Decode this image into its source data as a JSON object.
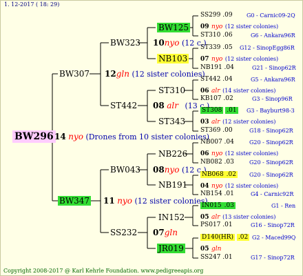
{
  "header": {
    "date": "1. 12-2017 ( 18: 29)"
  },
  "footer": {
    "copyright": "Copyright 2008-2017 @ Karl Kehrle Foundation.   www.pedigreeapis.org"
  },
  "root": {
    "id": "BW296",
    "gen": "14",
    "note_red": "nyo",
    "note": "(Drones from 10 sister colonies)"
  },
  "gen2": {
    "a": {
      "id": "BW307",
      "gen": "12",
      "note_red": "gln",
      "note": "(12 sister colonies)"
    },
    "b": {
      "id": "BW347",
      "gen": "11",
      "note_red": "nyo",
      "note": "(12 sister colonies)"
    }
  },
  "gen3": {
    "a": {
      "id": "BW323",
      "gen": "10",
      "note_red": "nyo",
      "note": "(12 c.)"
    },
    "b": {
      "id": "ST442",
      "gen": "08",
      "note_red": "alr",
      "note": "(13 c.)"
    },
    "c": {
      "id": "BW043",
      "gen": "08",
      "note_red": "nyo",
      "note": "(12 c.)"
    },
    "d": {
      "id": "SS232",
      "gen": "07",
      "note_red": "gln",
      "note": ""
    }
  },
  "gen4": [
    {
      "id": "BW125"
    },
    {
      "id": "NB103"
    },
    {
      "id": "ST310"
    },
    {
      "id": "ST343"
    },
    {
      "id": "NB226"
    },
    {
      "id": "NB191"
    },
    {
      "id": "IN152"
    },
    {
      "id": "JR019"
    }
  ],
  "gen5": [
    {
      "id": "SS299",
      "val": ".09",
      "loc": "G0 - Carnic09-2Q"
    },
    {
      "num": "09",
      "red": "nyo",
      "note": "(12 sister colonies)"
    },
    {
      "id": "ST310",
      "val": ".06",
      "loc": "G6 - Ankara96R"
    },
    {
      "id": "ST339",
      "val": ".05",
      "loc": "G12 - SinopEgg86R"
    },
    {
      "num": "07",
      "red": "nyo",
      "note": "(12 sister colonies)"
    },
    {
      "id": "NB191",
      "val": ".04",
      "loc": "G21 - Sinop62R"
    },
    {
      "id": "ST442",
      "val": ".04",
      "loc": "G5 - Ankara96R"
    },
    {
      "num": "06",
      "red": "alr",
      "note": "(14 sister colonies)"
    },
    {
      "id": "KB107",
      "val": ".02",
      "loc": "G3 - Sinop96R"
    },
    {
      "id": "ST308",
      "val": ".01",
      "loc": "G3 - Bayburt98-3"
    },
    {
      "num": "03",
      "red": "alr",
      "note": "(12 sister colonies)"
    },
    {
      "id": "ST369",
      "val": ".00",
      "loc": "G18 - Sinop62R"
    },
    {
      "id": "NB007",
      "val": ".04",
      "loc": "G20 - Sinop62R"
    },
    {
      "num": "06",
      "red": "nyo",
      "note": "(12 sister colonies)"
    },
    {
      "id": "NB082",
      "val": ".03",
      "loc": "G20 - Sinop62R"
    },
    {
      "id": "NB068",
      "val": ".02",
      "loc": "G20 - Sinop62R"
    },
    {
      "num": "04",
      "red": "nyo",
      "note": "(12 sister colonies)"
    },
    {
      "id": "NB154",
      "val": ".01",
      "loc": "G4 - Carnic92R"
    },
    {
      "id": "IN015",
      "val": ".03",
      "loc": "G1 - Ren"
    },
    {
      "num": "05",
      "red": "alr",
      "note": "(13 sister colonies)"
    },
    {
      "id": "PS017",
      "val": ".01",
      "loc": "G16 - Sinop72R"
    },
    {
      "id": "D140(HR)",
      "val": ".02",
      "loc": "G2 - Maced99Q"
    },
    {
      "num": "05",
      "red": "gln",
      "note": ""
    },
    {
      "id": "SS247",
      "val": ".01",
      "loc": "G17 - Sinop72R"
    }
  ]
}
